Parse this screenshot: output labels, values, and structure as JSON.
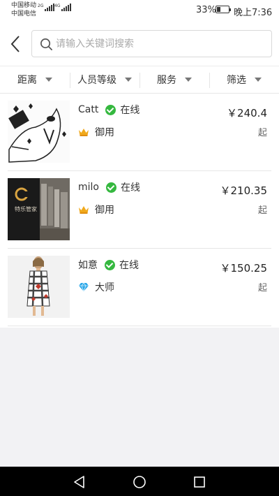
{
  "status_bar": {
    "carrier_1": "中国移动",
    "carrier_2": "中国电信",
    "signal_1_tag": "2G",
    "signal_2_tag": "4G",
    "battery": "33%",
    "battery_level": 0.33,
    "time": "晚上7:36"
  },
  "search": {
    "placeholder": "请输入关键词搜索",
    "value": ""
  },
  "filters": [
    {
      "label": "距离"
    },
    {
      "label": "人员等级"
    },
    {
      "label": "服务"
    },
    {
      "label": "筛选"
    }
  ],
  "results": [
    {
      "name": "Catt",
      "status": "在线",
      "level": "御用",
      "level_icon": "crown-icon",
      "price": "￥240.4",
      "price_suffix": "起"
    },
    {
      "name": "milo",
      "status": "在线",
      "level": "御用",
      "level_icon": "crown-icon",
      "price": "￥210.35",
      "price_suffix": "起",
      "thumb_sign": "特乐管家"
    },
    {
      "name": "如意",
      "status": "在线",
      "level": "大师",
      "level_icon": "diamond-icon",
      "price": "￥150.25",
      "price_suffix": "起"
    }
  ],
  "colors": {
    "online": "#35b83f",
    "crown": "#f0a91c",
    "diamond": "#2aa7e8",
    "background": "#f2f2f4"
  }
}
